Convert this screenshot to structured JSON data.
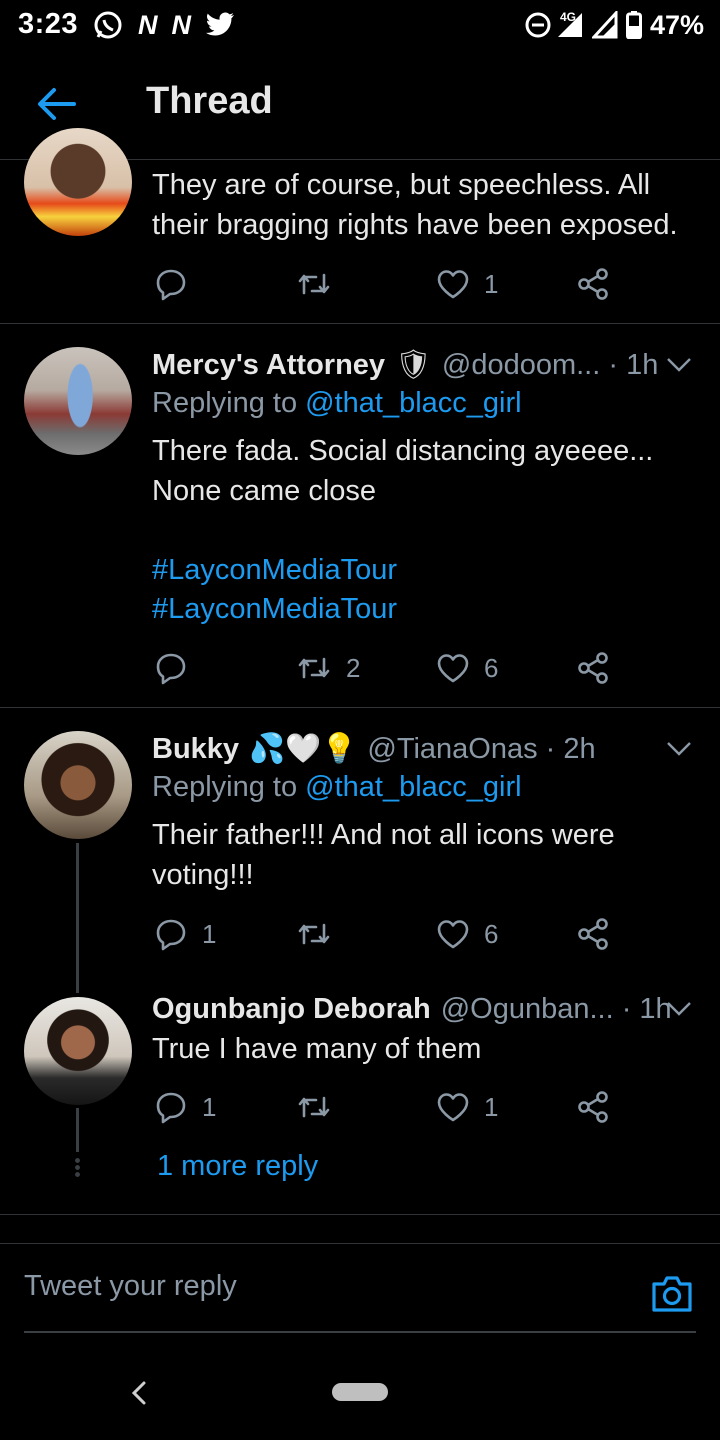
{
  "status_bar": {
    "time": "3:23",
    "notif_n1": "N",
    "notif_n2": "N",
    "network": "4G",
    "battery": "47%"
  },
  "header": {
    "title": "Thread",
    "back_icon": "arrow-left-icon"
  },
  "tweets": [
    {
      "body_lines": [
        "They are of course, but speechless. All",
        "their bragging rights have been exposed."
      ],
      "replies": "",
      "retweets": "",
      "likes": "1"
    },
    {
      "name": "Mercy's Attorney",
      "badge": "🛡",
      "handle": "@dodoom... · 1h",
      "reply_prefix": "Replying to ",
      "reply_to": "@that_blacc_girl",
      "body_lines": [
        "There fada. Social distancing ayeeee...",
        "None came close"
      ],
      "hashtags": [
        "#LayconMediaTour",
        "#LayconMediaTour"
      ],
      "replies": "",
      "retweets": "2",
      "likes": "6"
    },
    {
      "name": "Bukky",
      "badge": "💦🤍💡",
      "handle": "@TianaOnas · 2h",
      "reply_prefix": "Replying to ",
      "reply_to": "@that_blacc_girl",
      "body_lines": [
        "Their father!!! And not all icons were",
        "voting!!!"
      ],
      "replies": "1",
      "retweets": "",
      "likes": "6"
    },
    {
      "name": "Ogunbanjo Deborah",
      "handle": "@Ogunban... · 1h",
      "body_lines": [
        "True I have many of them"
      ],
      "replies": "1",
      "retweets": "",
      "likes": "1"
    }
  ],
  "more_replies": "1 more reply",
  "composer": {
    "placeholder": "Tweet your reply",
    "camera_icon": "camera-icon"
  },
  "colors": {
    "accent": "#1d9bf0",
    "muted": "#8b98a5",
    "background": "#000000"
  }
}
